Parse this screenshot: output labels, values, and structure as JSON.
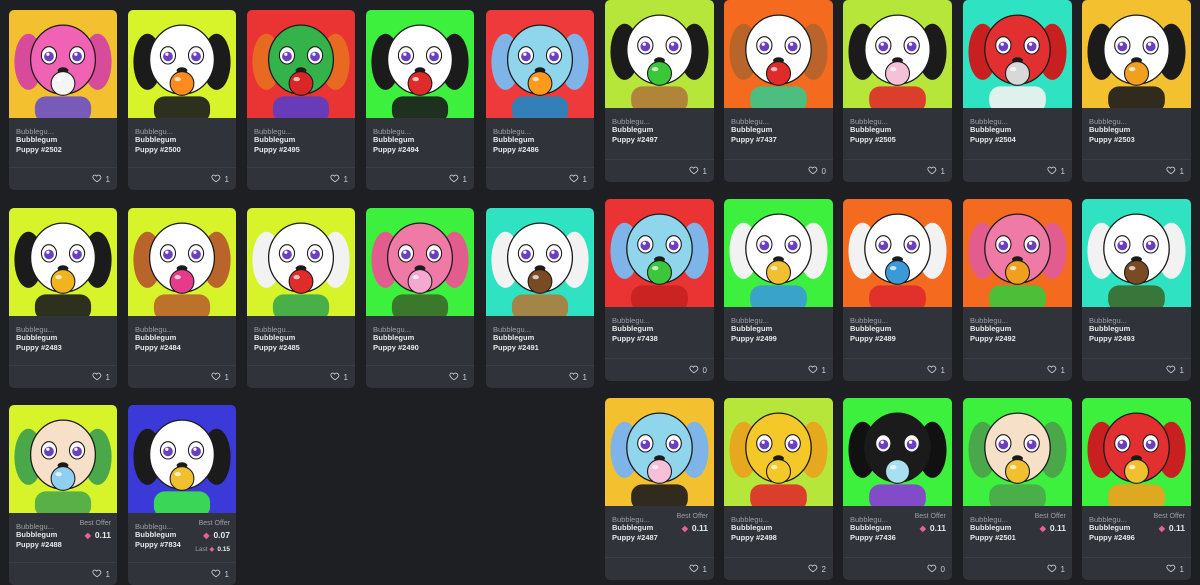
{
  "labels": {
    "collection": "Bubblegu...",
    "best_offer": "Best Offer",
    "last": "Last"
  },
  "cards": [
    {
      "title_line1": "Bubblegum",
      "title_line2": "Puppy #2502",
      "likes": "1",
      "bg": "#f3c12f",
      "fur": "#f062b4",
      "ear": "#d84a9a",
      "gum": "#f5f5f5",
      "accent": "#6a4fc8"
    },
    {
      "title_line1": "Bubblegum",
      "title_line2": "Puppy #2500",
      "likes": "1",
      "bg": "#d7f32a",
      "fur": "#ffffff",
      "ear": "#1b1b1b",
      "gum": "#ff8a1e",
      "accent": "#1b1b1b"
    },
    {
      "title_line1": "Bubblegum",
      "title_line2": "Puppy #2495",
      "likes": "1",
      "bg": "#ea3333",
      "fur": "#33b34a",
      "ear": "#e86a22",
      "gum": "#d92626",
      "accent": "#5a3cc8"
    },
    {
      "title_line1": "Bubblegum",
      "title_line2": "Puppy #2494",
      "likes": "1",
      "bg": "#3ef03e",
      "fur": "#ffffff",
      "ear": "#1b1b1b",
      "gum": "#e02b2b",
      "accent": "#1b1b1b"
    },
    {
      "title_line1": "Bubblegum",
      "title_line2": "Puppy #2486",
      "likes": "1",
      "bg": "#ee3a3a",
      "fur": "#8fd6ec",
      "ear": "#7fb4e8",
      "gum": "#ff9a1e",
      "accent": "#1e88c8"
    },
    {
      "title_line1": "Bubblegum",
      "title_line2": "Puppy #2483",
      "likes": "1",
      "bg": "#d7f32a",
      "fur": "#ffffff",
      "ear": "#1b1b1b",
      "gum": "#f0b41e",
      "accent": "#1b1b1b"
    },
    {
      "title_line1": "Bubblegum",
      "title_line2": "Puppy #2484",
      "likes": "1",
      "bg": "#d7f32a",
      "fur": "#ffffff",
      "ear": "#b9642a",
      "gum": "#e83a8a",
      "accent": "#b9642a"
    },
    {
      "title_line1": "Bubblegum",
      "title_line2": "Puppy #2485",
      "likes": "1",
      "bg": "#d7f32a",
      "fur": "#ffffff",
      "ear": "#f2f2f2",
      "gum": "#e02b2b",
      "accent": "#3aa84a"
    },
    {
      "title_line1": "Bubblegum",
      "title_line2": "Puppy #2490",
      "likes": "1",
      "bg": "#3ef03e",
      "fur": "#f07aa6",
      "ear": "#e25c8e",
      "gum": "#f5a8d0",
      "accent": "#3a6a2a"
    },
    {
      "title_line1": "Bubblegum",
      "title_line2": "Puppy #2491",
      "likes": "1",
      "bg": "#2fe3c2",
      "fur": "#ffffff",
      "ear": "#f2f2f2",
      "gum": "#7a4a22",
      "accent": "#b07a3a"
    },
    {
      "title_line1": "Bubblegum",
      "title_line2": "Puppy #2488",
      "likes": "1",
      "bg": "#d7f32a",
      "fur": "#f6e0c8",
      "ear": "#4aa84a",
      "gum": "#8fd0f0",
      "accent": "#4aa84a",
      "best_offer": "0.11"
    },
    {
      "title_line1": "Bubblegum",
      "title_line2": "Puppy #7834",
      "likes": "1",
      "bg": "#3b3ad8",
      "fur": "#ffffff",
      "ear": "#1b1b1b",
      "gum": "#f0c030",
      "accent": "#3ae84a",
      "best_offer": "0.07",
      "last": "0.15"
    },
    {
      "title_line1": "Bubblegum",
      "title_line2": "Puppy #2497",
      "likes": "1",
      "bg": "#b6e63a",
      "fur": "#ffffff",
      "ear": "#1b1b1b",
      "gum": "#3ac83a",
      "accent": "#b07a3a"
    },
    {
      "title_line1": "Bubblegum",
      "title_line2": "Puppy #7437",
      "likes": "0",
      "bg": "#f46a1e",
      "fur": "#ffffff",
      "ear": "#b9642a",
      "gum": "#e02b2b",
      "accent": "#3ac88a"
    },
    {
      "title_line1": "Bubblegum",
      "title_line2": "Puppy #2505",
      "likes": "1",
      "bg": "#b6e63a",
      "fur": "#ffffff",
      "ear": "#1b1b1b",
      "gum": "#f5c0d8",
      "accent": "#e02b2b"
    },
    {
      "title_line1": "Bubblegum",
      "title_line2": "Puppy #2504",
      "likes": "1",
      "bg": "#2fe3c2",
      "fur": "#e23030",
      "ear": "#c82020",
      "gum": "#d8d8d8",
      "accent": "#f2f2f2"
    },
    {
      "title_line1": "Bubblegum",
      "title_line2": "Puppy #2503",
      "likes": "1",
      "bg": "#f3c12f",
      "fur": "#ffffff",
      "ear": "#1b1b1b",
      "gum": "#f0a01e",
      "accent": "#1b1b1b"
    },
    {
      "title_line1": "Bubblegum",
      "title_line2": "Puppy #7438",
      "likes": "0",
      "bg": "#ea3333",
      "fur": "#8fd6ec",
      "ear": "#7fb4e8",
      "gum": "#3ac83a",
      "accent": "#c82020"
    },
    {
      "title_line1": "Bubblegum",
      "title_line2": "Puppy #2499",
      "likes": "1",
      "bg": "#3ef03e",
      "fur": "#ffffff",
      "ear": "#f2f2f2",
      "gum": "#f0c030",
      "accent": "#3a9ad8"
    },
    {
      "title_line1": "Bubblegum",
      "title_line2": "Puppy #2489",
      "likes": "1",
      "bg": "#f46a1e",
      "fur": "#ffffff",
      "ear": "#f2f2f2",
      "gum": "#3a9ad8",
      "accent": "#e02b2b"
    },
    {
      "title_line1": "Bubblegum",
      "title_line2": "Puppy #2492",
      "likes": "1",
      "bg": "#f46a1e",
      "fur": "#f07aa6",
      "ear": "#e25c8e",
      "gum": "#f0a01e",
      "accent": "#3ac83a"
    },
    {
      "title_line1": "Bubblegum",
      "title_line2": "Puppy #2493",
      "likes": "1",
      "bg": "#2fe3c2",
      "fur": "#ffffff",
      "ear": "#f2f2f2",
      "gum": "#7a4a22",
      "accent": "#3a6a2a"
    },
    {
      "title_line1": "Bubblegum",
      "title_line2": "Puppy #2487",
      "likes": "1",
      "bg": "#f3c12f",
      "fur": "#8fd6ec",
      "ear": "#7fb4e8",
      "gum": "#f5c0d8",
      "accent": "#1b1b1b",
      "best_offer": "0.11"
    },
    {
      "title_line1": "Bubblegum",
      "title_line2": "Puppy #2498",
      "likes": "2",
      "bg": "#b6e63a",
      "fur": "#f5c82a",
      "ear": "#e6a81e",
      "gum": "#f5c82a",
      "accent": "#e02b2b"
    },
    {
      "title_line1": "Bubblegum",
      "title_line2": "Puppy #7436",
      "likes": "0",
      "bg": "#3ef03e",
      "fur": "#1b1b1b",
      "ear": "#111111",
      "gum": "#a8e0f0",
      "accent": "#8a3ad8",
      "best_offer": "0.11"
    },
    {
      "title_line1": "Bubblegum",
      "title_line2": "Puppy #2501",
      "likes": "1",
      "bg": "#3ef03e",
      "fur": "#f6e0c8",
      "ear": "#4aa84a",
      "gum": "#f0c030",
      "accent": "#4aa84a",
      "best_offer": "0.11"
    },
    {
      "title_line1": "Bubblegum",
      "title_line2": "Puppy #2496",
      "likes": "1",
      "bg": "#3ef03e",
      "fur": "#e23030",
      "ear": "#c82020",
      "gum": "#f0c030",
      "accent": "#f0a01e",
      "best_offer": "0.11"
    }
  ]
}
